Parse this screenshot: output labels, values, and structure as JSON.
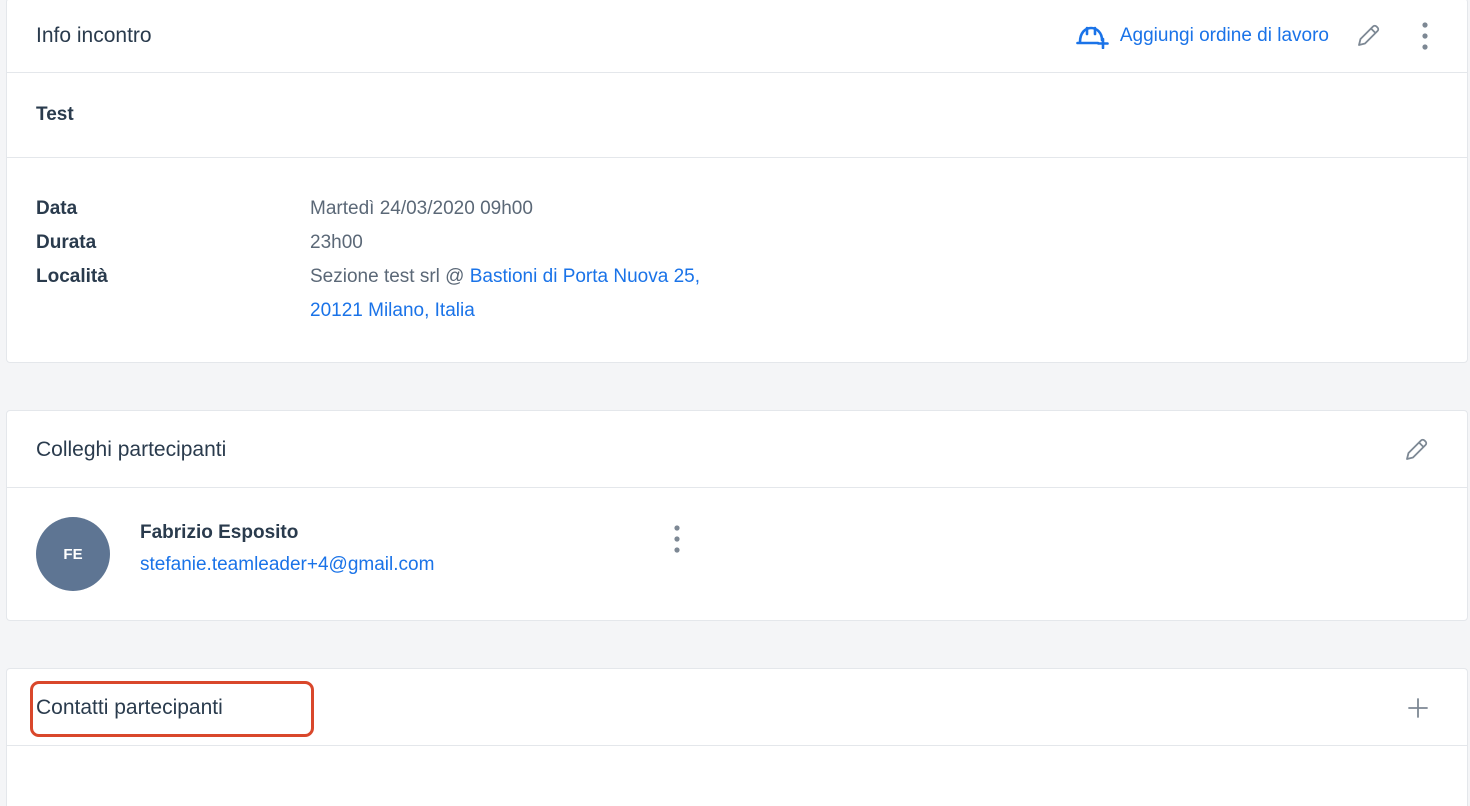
{
  "info_card": {
    "title": "Info incontro",
    "add_work_order_label": "Aggiungi ordine di lavoro",
    "subject": "Test",
    "details": {
      "date_label": "Data",
      "date_value": "Martedì 24/03/2020 09h00",
      "duration_label": "Durata",
      "duration_value": "23h00",
      "location_label": "Località",
      "location_company": "Sezione test srl @ ",
      "location_address": "Bastioni di Porta Nuova 25, 20121 Milano, Italia"
    }
  },
  "colleagues_card": {
    "title": "Colleghi partecipanti",
    "participants": [
      {
        "initials": "FE",
        "name": "Fabrizio Esposito",
        "email": "stefanie.teamleader+4@gmail.com"
      }
    ]
  },
  "contacts_card": {
    "title": "Contatti partecipanti"
  },
  "icons": {
    "work_order": "hard-hat-plus-icon",
    "edit": "pencil-icon",
    "more": "kebab-menu-icon",
    "add": "plus-icon"
  },
  "colors": {
    "accent": "#1a73e8",
    "avatar_bg": "#5e7593",
    "highlight": "#d9472b",
    "background": "#f4f5f7"
  }
}
